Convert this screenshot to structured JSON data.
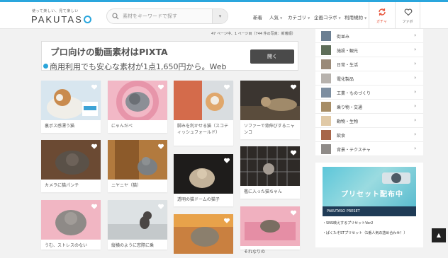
{
  "header": {
    "tagline": "使って楽しい、見て楽しい",
    "logo": "PAKUTAS",
    "search_placeholder": "素材をキーワードで探す",
    "nav": [
      {
        "label": "新着"
      },
      {
        "label": "人気"
      },
      {
        "label": "カテゴリ"
      },
      {
        "label": "企画コラボ"
      },
      {
        "label": "利用規約"
      }
    ],
    "gacha_label": "ガチャ",
    "fav_label": "ファボ"
  },
  "results": {
    "count_text": "47 ページ中、1 ページ目（744 件の写真：新着順）"
  },
  "ad": {
    "title": "プロ向けの動画素材はPIXTA",
    "subtitle": "商用利用でも安心な素材が1点1,650円から。Web",
    "button": "開く"
  },
  "photos": [
    {
      "caption": "裏ボス感漂う猫"
    },
    {
      "caption": "にゃんだべ"
    },
    {
      "caption": "脚みを利かせる猫（スコティッシュフォールド）"
    },
    {
      "caption": "ソファーで背伸びするニャンコ"
    },
    {
      "caption": "カメラに猫パンチ"
    },
    {
      "caption": "ニヤニヤ（猫）"
    },
    {
      "caption": "透明の猫ドームの猫子"
    },
    {
      "caption": "檻に入った猫ちゃん"
    },
    {
      "caption": "うむ、ストレスのない"
    },
    {
      "caption": "縦横のように窓際に乗"
    },
    {
      "caption": ""
    },
    {
      "caption": "それなりの"
    }
  ],
  "sidebar": {
    "categories": [
      {
        "label": "街並み"
      },
      {
        "label": "施設・観光"
      },
      {
        "label": "日常・生活"
      },
      {
        "label": "電化製品"
      },
      {
        "label": "工業・ものづくり"
      },
      {
        "label": "乗り物・交通"
      },
      {
        "label": "動物・生物"
      },
      {
        "label": "飲食"
      },
      {
        "label": "背景・テクスチャ"
      }
    ],
    "banner_title": "プリセット配布中",
    "banner_footer": "PAKUTASO PRESET",
    "links": [
      {
        "label": "・SNS映えするプリセットVer2"
      },
      {
        "label": "・ぱくたそSTプリセット（1番人気の詰め合わせ！）"
      }
    ]
  },
  "page_top_label": "▲",
  "colors": {
    "accent": "#2aa6dd",
    "gacha": "#e8553b"
  }
}
